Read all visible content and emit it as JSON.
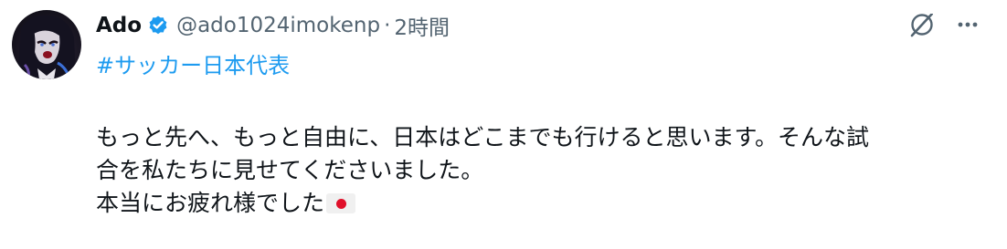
{
  "tweet": {
    "author": {
      "display_name": "Ado",
      "handle": "@ado1024imokenp",
      "verified": true
    },
    "separator": "·",
    "timestamp": "2時間",
    "hashtag": "#サッカー日本代表",
    "body_lines": [
      "もっと先へ、もっと自由に、日本はどこまでも行けると思います。そんな試",
      "合を私たちに見せてくださいました。",
      "本当にお疲れ様でした"
    ],
    "emoji": "flag-japan"
  },
  "icons": {
    "verified": "verified-badge-icon",
    "grok": "grok-icon",
    "more": "more-horizontal-icon"
  },
  "colors": {
    "text": "#0f1419",
    "secondary": "#536471",
    "accent": "#1d9bf0",
    "flag_red": "#e0102a"
  }
}
